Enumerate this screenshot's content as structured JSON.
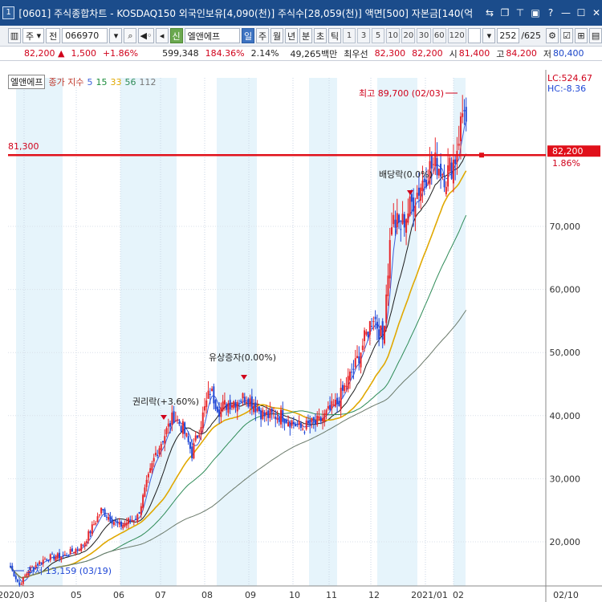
{
  "window": {
    "index": "1",
    "title": "[0601] 주식종합차트 - KOSDAQ150 외국인보유[4,090(천)] 주식수[28,059(천)] 액면[500] 자본금[140(억"
  },
  "toolbar": {
    "type": "주",
    "market": "전",
    "code": "066970",
    "name": "엘앤에프",
    "badge": "신",
    "periods_active": "일",
    "periods": [
      "일",
      "주",
      "월",
      "년",
      "분",
      "초",
      "틱"
    ],
    "intervals": [
      "1",
      "3",
      "5",
      "10",
      "20",
      "30",
      "60",
      "120"
    ],
    "count": "252",
    "total": "/625"
  },
  "quote": {
    "price": "82,200 ▲",
    "change": "1,500",
    "change_pct": "+1.86%",
    "volume": "599,348",
    "vol_ratio": "184.36%",
    "turnover": "2.14%",
    "amount": "49,265백만",
    "broker": "최우선",
    "bid": "82,300",
    "ask": "82,200",
    "open_label": "시",
    "open": "81,400",
    "high_label": "고",
    "high": "84,200",
    "low_label": "저",
    "low": "80,400"
  },
  "legend": {
    "name": "엘앤에프",
    "ma_label": "종가 지수",
    "ma": [
      "5",
      "15",
      "33",
      "56",
      "112"
    ],
    "ma_colors": [
      "#3d5fd9",
      "#1a8c3a",
      "#e0a800",
      "#2e8b57",
      "#777777"
    ]
  },
  "annotations": {
    "high": "최고 89,700 (02/03)",
    "low": "최저 13,159 (03/19)",
    "rights": "권리락(+3.60%)",
    "paid_in": "유상증자(0.00%)",
    "dividend": "배당락(0.0%)",
    "hline_left": "81,300",
    "price_tag": "82,200",
    "pct_tag": "1.86%",
    "lc": "LC:524.67",
    "hc": "HC:-8.36"
  },
  "chart_data": {
    "type": "candlestick",
    "title": "엘앤에프",
    "x_labels": [
      "2020/03",
      "05",
      "06",
      "07",
      "08",
      "09",
      "10",
      "11",
      "12",
      "2021/01",
      "02",
      "02/10"
    ],
    "y_ticks": [
      "20,000",
      "30,000",
      "40,000",
      "50,000",
      "60,000",
      "70,000"
    ],
    "ylim": [
      13000,
      90000
    ],
    "close_path": [
      [
        0,
        16000
      ],
      [
        5,
        13159
      ],
      [
        10,
        15500
      ],
      [
        20,
        17500
      ],
      [
        30,
        17800
      ],
      [
        40,
        19500
      ],
      [
        50,
        25000
      ],
      [
        60,
        22500
      ],
      [
        70,
        24000
      ],
      [
        80,
        34000
      ],
      [
        90,
        40000
      ],
      [
        95,
        38000
      ],
      [
        100,
        34000
      ],
      [
        110,
        44000
      ],
      [
        115,
        41000
      ],
      [
        120,
        42000
      ],
      [
        130,
        43000
      ],
      [
        140,
        40000
      ],
      [
        150,
        40000
      ],
      [
        160,
        38000
      ],
      [
        170,
        39000
      ],
      [
        180,
        42000
      ],
      [
        190,
        48000
      ],
      [
        200,
        56000
      ],
      [
        205,
        52000
      ],
      [
        210,
        71000
      ],
      [
        215,
        70000
      ],
      [
        220,
        73000
      ],
      [
        225,
        76000
      ],
      [
        230,
        79000
      ],
      [
        235,
        80000
      ],
      [
        240,
        78000
      ],
      [
        245,
        81000
      ],
      [
        250,
        89700
      ],
      [
        252,
        82200
      ]
    ],
    "current_price": 82200,
    "reference_line": 81300
  }
}
